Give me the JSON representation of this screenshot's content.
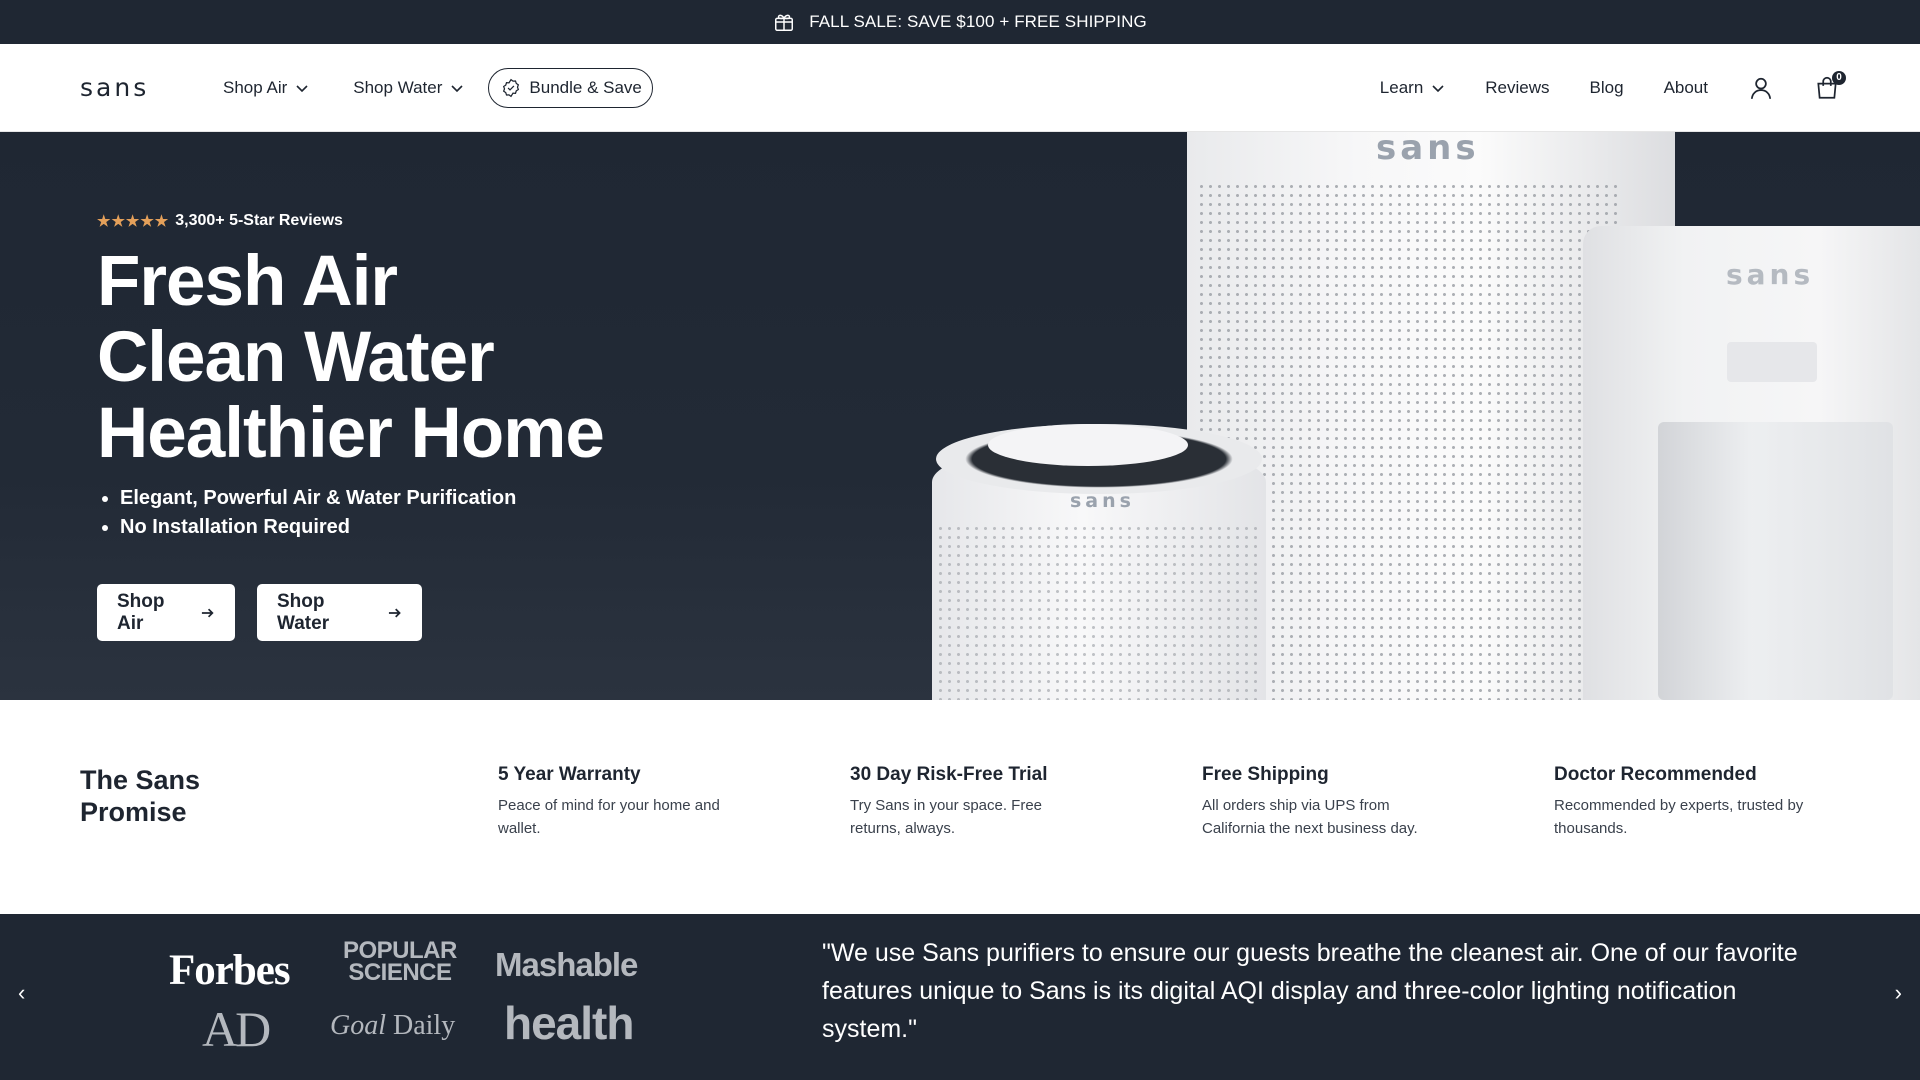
{
  "announcement": {
    "text": "FALL SALE: SAVE $100 + FREE SHIPPING",
    "icon": "gift-icon"
  },
  "header": {
    "logo": "sans",
    "nav_left": [
      {
        "label": "Shop Air",
        "has_dropdown": true
      },
      {
        "label": "Shop Water",
        "has_dropdown": true
      }
    ],
    "bundle_label": "Bundle & Save",
    "nav_right": [
      {
        "label": "Learn",
        "has_dropdown": true
      },
      {
        "label": "Reviews"
      },
      {
        "label": "Blog"
      },
      {
        "label": "About"
      }
    ],
    "cart_count": "0"
  },
  "hero": {
    "stars": "★★★★★",
    "rating_text": "3,300+ 5-Star Reviews",
    "headline": [
      "Fresh Air",
      "Clean Water",
      "Healthier Home"
    ],
    "bullets": [
      "Elegant, Powerful Air & Water Purification",
      "No Installation Required"
    ],
    "cta_air": "Shop Air",
    "cta_water": "Shop Water",
    "product_brand": "sans"
  },
  "promise": {
    "title_line1": "The Sans",
    "title_line2": "Promise",
    "features": [
      {
        "title": "5 Year Warranty",
        "text": "Peace of mind for your home and wallet."
      },
      {
        "title": "30 Day Risk-Free Trial",
        "text": "Try Sans in your space. Free returns, always."
      },
      {
        "title": "Free Shipping",
        "text": "All orders ship via UPS from California the next business day."
      },
      {
        "title": "Doctor Recommended",
        "text": "Recommended by experts, trusted by thousands."
      }
    ]
  },
  "press": {
    "logos": [
      "Forbes",
      "POPULAR",
      "SCIENCE",
      "Mashable",
      "AD",
      "Goal",
      "Daily",
      "health"
    ],
    "quote": "\"We use Sans purifiers to ensure our guests breathe the cleanest air. One of our favorite features unique to Sans is its digital AQI display and three-color lighting notification system.\"",
    "prev_arrow": "‹",
    "next_arrow": "›"
  },
  "colors": {
    "navy": "#1f2733",
    "star": "#e4a05a",
    "white": "#ffffff"
  }
}
